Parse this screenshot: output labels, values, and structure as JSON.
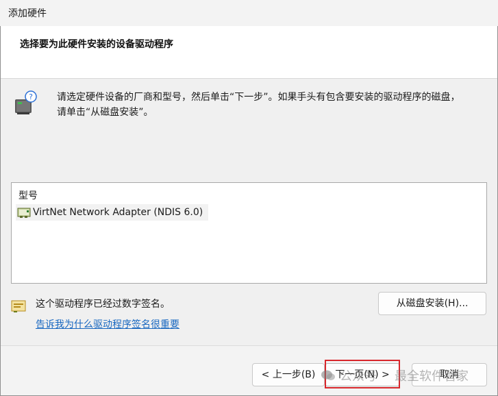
{
  "window": {
    "title": "添加硬件"
  },
  "header": {
    "title": "选择要为此硬件安装的设备驱动程序"
  },
  "instruction": {
    "line1": "请选定硬件设备的厂商和型号，然后单击“下一步”。如果手头有包含要安装的驱动程序的磁盘，",
    "line2": "请单击“从磁盘安装”。"
  },
  "model_list": {
    "header": "型号",
    "items": [
      {
        "label": "VirtNet Network Adapter (NDIS 6.0)"
      }
    ]
  },
  "signature": {
    "status": "这个驱动程序已经过数字签名。",
    "link": "告诉我为什么驱动程序签名很重要"
  },
  "buttons": {
    "have_disk": "从磁盘安装(H)...",
    "back": "< 上一步(B)",
    "next": "下一页(N) >",
    "cancel": "取消"
  },
  "watermark": {
    "part1": "公众号",
    "part2": "最全软件管家"
  },
  "colors": {
    "link": "#1867c0",
    "highlight": "#d8262b",
    "selection": "#f2f2f2"
  },
  "icons": {
    "hardware": "hardware-question-icon",
    "adapter": "network-adapter-icon",
    "signed": "signed-driver-icon",
    "watermark": "wechat-icon"
  }
}
